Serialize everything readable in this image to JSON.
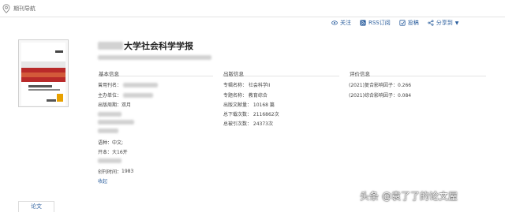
{
  "breadcrumb": {
    "label": "期刊导航"
  },
  "actions": {
    "follow": "关注",
    "rss": "RSS订阅",
    "submit": "投稿",
    "share": "分享到"
  },
  "journal": {
    "title_suffix": "大学社会科学学报"
  },
  "basic_info": {
    "heading": "基本信息",
    "former_name_label": "曾用刊名：",
    "sponsor_label": "主办单位：",
    "frequency": "出版周期：双月",
    "language": "语种：中文;",
    "format": "开本：大16开",
    "founded_label": "创刊时间：",
    "founded_value": "1983",
    "collect_link": "收起"
  },
  "publication_info": {
    "heading": "出版信息",
    "special_name": "专辑名称：  社会科学II",
    "topic_name": "专题名称：  教育综合",
    "article_count": "出版文献量：  10168 篇",
    "downloads": "总下载次数：  2116862次",
    "citations": "总被引次数：  24373次"
  },
  "eval_info": {
    "heading": "评价信息",
    "composite_if": "(2021)复合影响因子：0.266",
    "comprehensive_if": "(2021)综合影响因子：0.084"
  },
  "tabs": {
    "articles": "论文"
  },
  "watermark": {
    "platform": "头条",
    "author": "@袁了了的论文屋"
  },
  "icons": {
    "pin": "location-pin-icon",
    "eye": "eye-icon",
    "rss": "rss-icon",
    "submit": "submit-icon",
    "share": "share-icon"
  },
  "colors": {
    "link": "#2c5f9e",
    "cover_red": "#b92a2a",
    "cover_orange": "#e8a100"
  }
}
